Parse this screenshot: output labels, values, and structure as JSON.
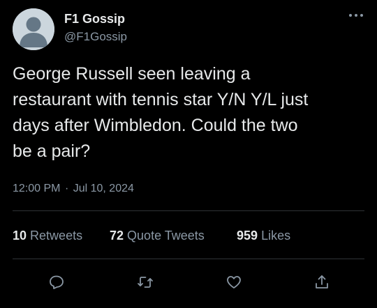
{
  "tweet": {
    "display_name": "F1 Gossip",
    "handle": "@F1Gossip",
    "text": "George Russell seen leaving a\nrestaurant with tennis star Y/N Y/L just\ndays after Wimbledon. Could the two\nbe a pair?",
    "time": "12:00 PM",
    "separator": "·",
    "date": "Jul 10, 2024"
  },
  "stats": {
    "retweets_count": "10",
    "retweets_label": "Retweets",
    "quotes_count": "72",
    "quotes_label": "Quote Tweets",
    "likes_count": "959",
    "likes_label": "Likes"
  },
  "icons": {
    "more": "more-horizontal-icon",
    "reply": "reply-icon",
    "retweet": "retweet-icon",
    "like": "heart-icon",
    "share": "share-icon",
    "avatar": "default-avatar-icon"
  },
  "colors": {
    "background": "#000000",
    "primary_text": "#e7e9ea",
    "secondary_text": "#8b98a5",
    "divider": "#2f3336",
    "avatar_bg": "#ccd6dd",
    "avatar_fg": "#657786"
  }
}
